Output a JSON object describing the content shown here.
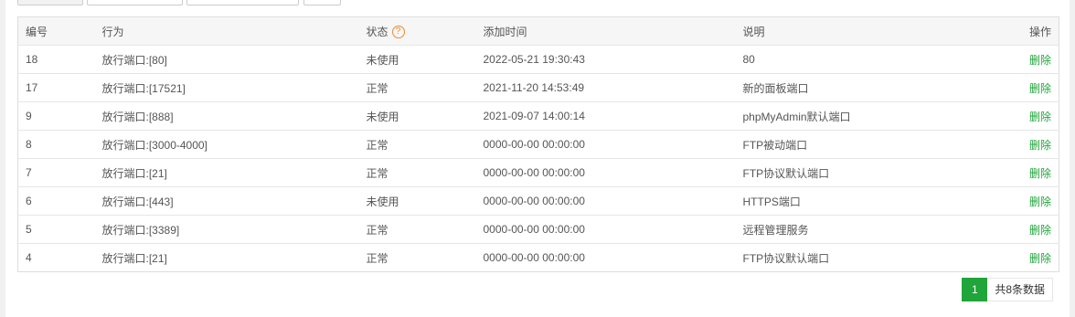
{
  "table": {
    "headers": {
      "id": "编号",
      "action": "行为",
      "status": "状态",
      "status_help_icon": "?",
      "time": "添加时间",
      "note": "说明",
      "op": "操作"
    },
    "rows": [
      {
        "id": "18",
        "action": "放行端口:[80]",
        "status": "未使用",
        "time": "2022-05-21 19:30:43",
        "note": "80",
        "op": "删除"
      },
      {
        "id": "17",
        "action": "放行端口:[17521]",
        "status": "正常",
        "time": "2021-11-20 14:53:49",
        "note": "新的面板端口",
        "op": "删除"
      },
      {
        "id": "9",
        "action": "放行端口:[888]",
        "status": "未使用",
        "time": "2021-09-07 14:00:14",
        "note": "phpMyAdmin默认端口",
        "op": "删除"
      },
      {
        "id": "8",
        "action": "放行端口:[3000-4000]",
        "status": "正常",
        "time": "0000-00-00 00:00:00",
        "note": "FTP被动端口",
        "op": "删除"
      },
      {
        "id": "7",
        "action": "放行端口:[21]",
        "status": "正常",
        "time": "0000-00-00 00:00:00",
        "note": "FTP协议默认端口",
        "op": "删除"
      },
      {
        "id": "6",
        "action": "放行端口:[443]",
        "status": "未使用",
        "time": "0000-00-00 00:00:00",
        "note": "HTTPS端口",
        "op": "删除"
      },
      {
        "id": "5",
        "action": "放行端口:[3389]",
        "status": "正常",
        "time": "0000-00-00 00:00:00",
        "note": "远程管理服务",
        "op": "删除"
      },
      {
        "id": "4",
        "action": "放行端口:[21]",
        "status": "正常",
        "time": "0000-00-00 00:00:00",
        "note": "FTP协议默认端口",
        "op": "删除"
      }
    ]
  },
  "pager": {
    "current_page": "1",
    "total_text": "共8条数据"
  },
  "colors": {
    "accent": "#20a53a",
    "help_icon": "#f0892e"
  }
}
